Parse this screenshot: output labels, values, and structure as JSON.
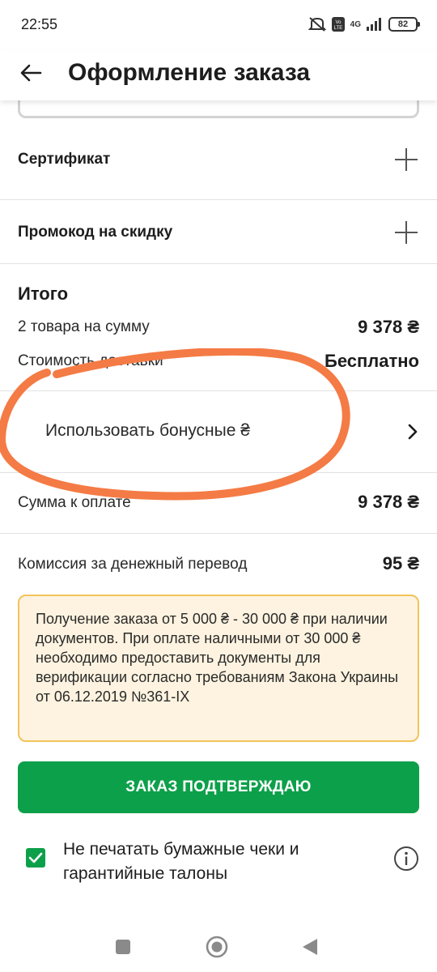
{
  "status_bar": {
    "time": "22:55",
    "network": "4G",
    "battery": "82"
  },
  "header": {
    "title": "Оформление заказа"
  },
  "certificate": {
    "label": "Сертификат"
  },
  "promo": {
    "label": "Промокод на скидку"
  },
  "total": {
    "title": "Итого",
    "items_label": "2 товара на сумму",
    "items_value": "9 378 ₴",
    "delivery_label": "Стоимость доставки",
    "delivery_value": "Бесплатно"
  },
  "bonus": {
    "label": "Использовать бонусные ₴"
  },
  "payment": {
    "label": "Сумма к оплате",
    "value": "9 378 ₴"
  },
  "commission": {
    "label": "Комиссия за денежный перевод",
    "value": "95 ₴"
  },
  "notice": {
    "text": "Получение заказа от 5 000 ₴ - 30 000 ₴ при наличии документов. При оплате наличными от 30 000 ₴ необходимо предоставить документы для верификации согласно требованиям Закона Украины от 06.12.2019 №361-IX"
  },
  "confirm_button": {
    "label": "ЗАКАЗ ПОДТВЕРЖДАЮ"
  },
  "receipts_option": {
    "label": "Не печатать бумажные чеки и гарантийные талоны",
    "checked": true
  },
  "colors": {
    "accent": "#0da04a",
    "notice_bg": "#fdf3e0",
    "notice_border": "#f3c35b",
    "annotation": "#f47b45"
  }
}
